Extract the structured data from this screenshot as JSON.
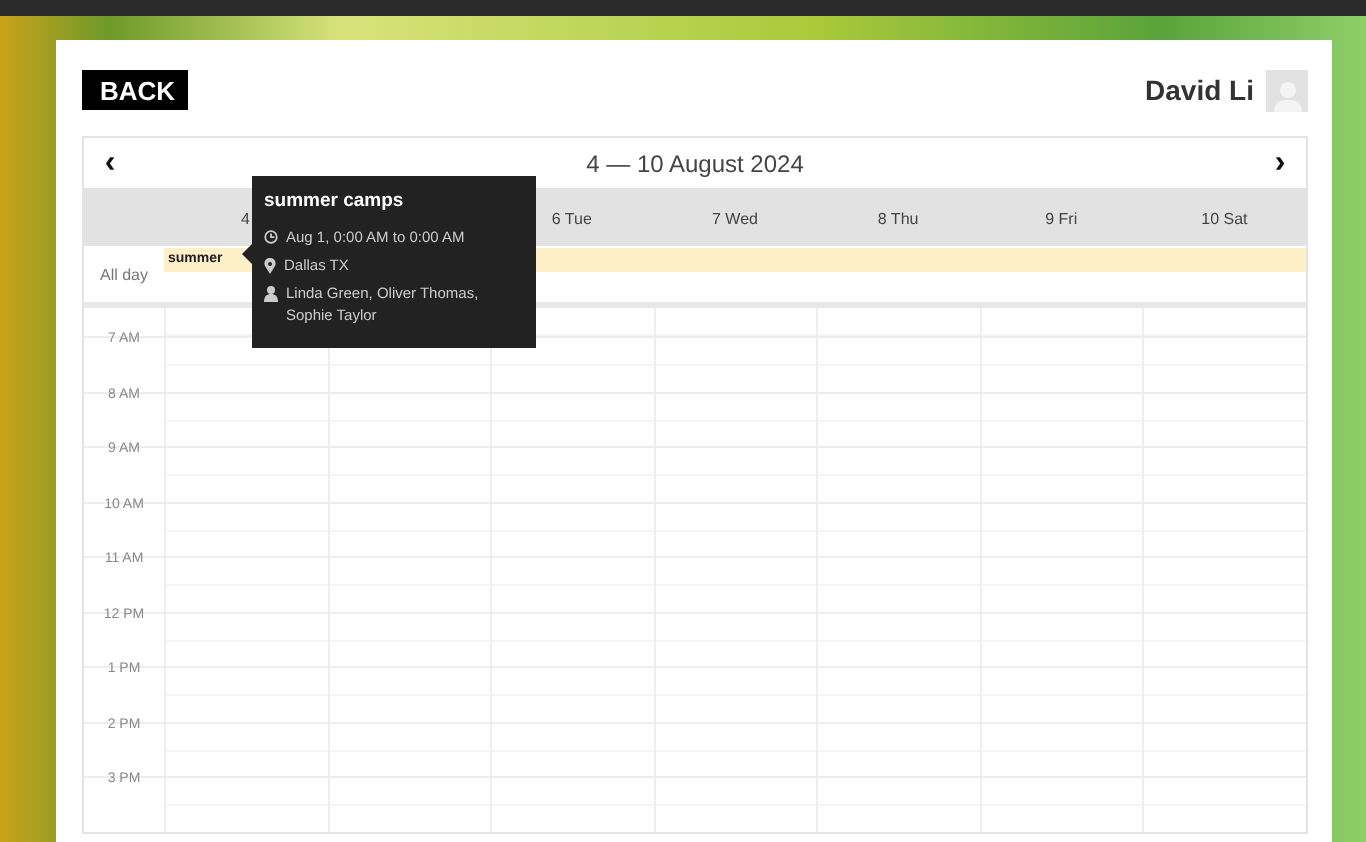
{
  "back_button": {
    "label": "BACK"
  },
  "user": {
    "name": "David Li"
  },
  "calendar": {
    "title": "4 — 10 August 2024",
    "prev": "‹",
    "next": "›",
    "days": [
      "4",
      "6 Tue",
      "7 Wed",
      "8 Thu",
      "9 Fri",
      "10 Sat"
    ],
    "all_day_label": "All day",
    "all_day_event": {
      "title": "summer",
      "color": "#fdf0c8"
    },
    "hours": [
      "7 AM",
      "8 AM",
      "9 AM",
      "10 AM",
      "11 AM",
      "12 PM",
      "1 PM",
      "2 PM",
      "3 PM"
    ]
  },
  "tooltip": {
    "title": "summer camps",
    "time": "Aug 1, 0:00 AM to 0:00 AM",
    "location": "Dallas TX",
    "people": "Linda Green, Oliver Thomas, Sophie Taylor"
  }
}
